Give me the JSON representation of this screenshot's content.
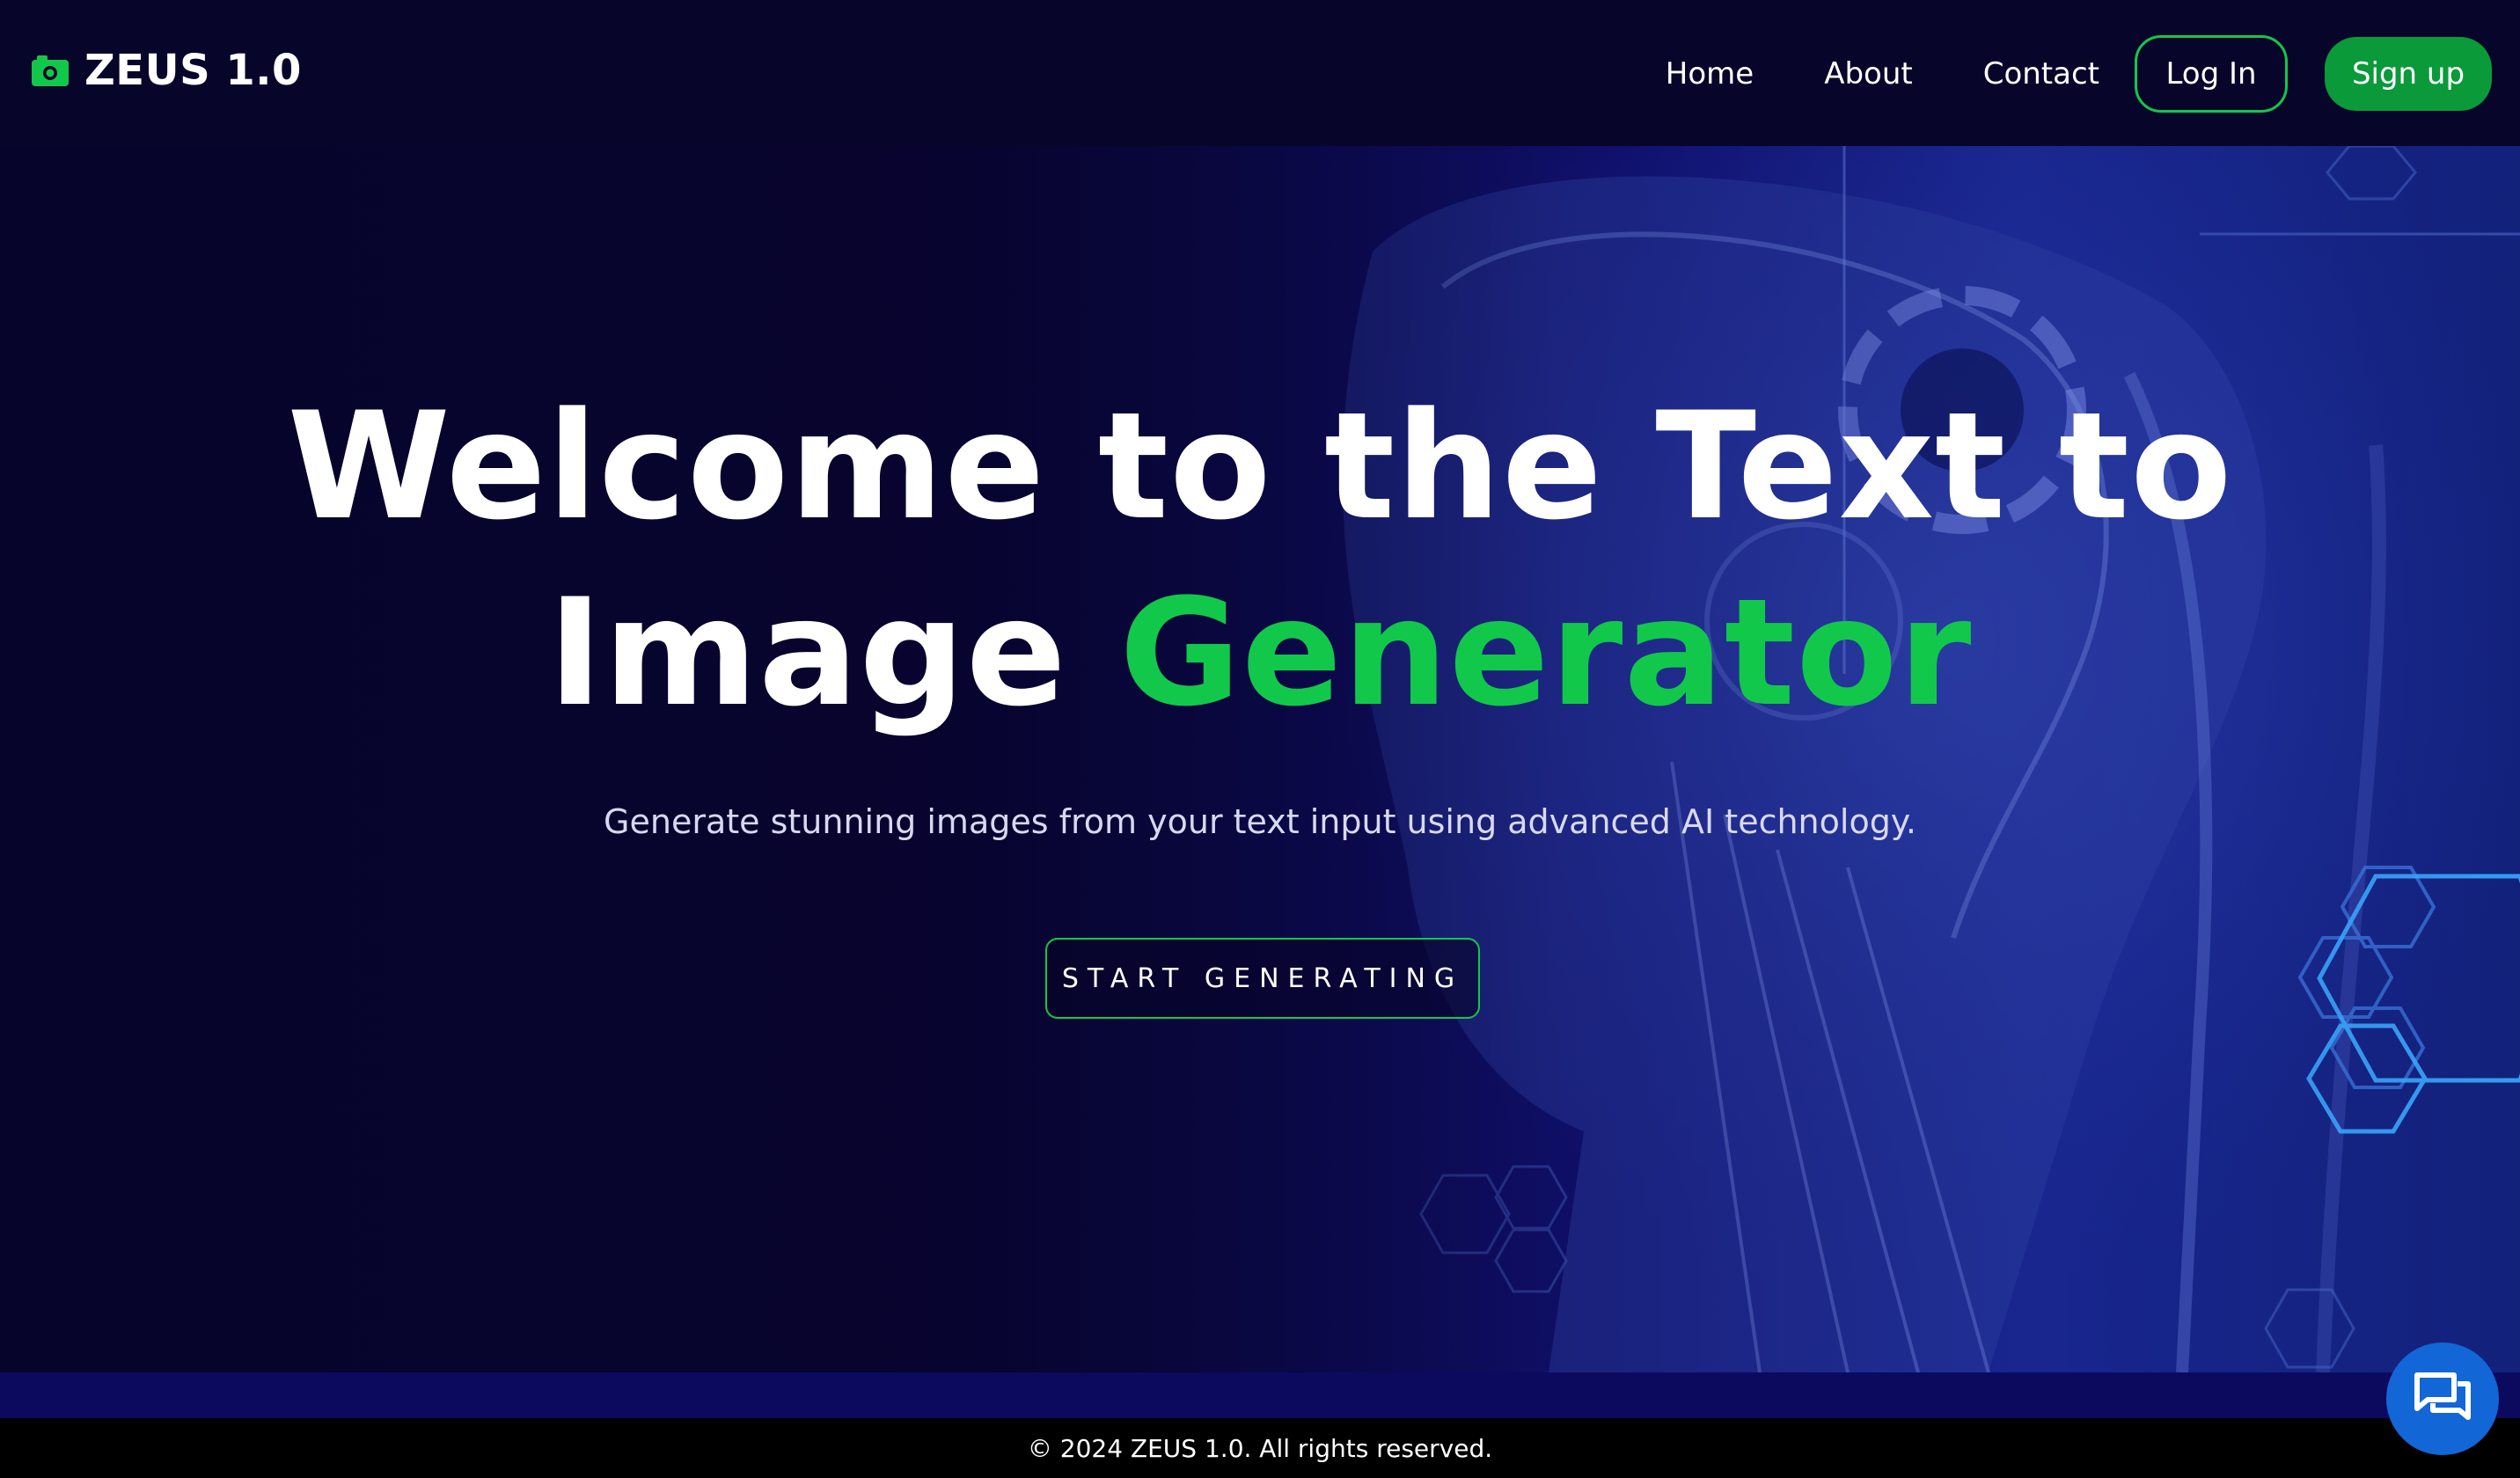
{
  "header": {
    "brand": "ZEUS 1.0",
    "brand_icon": "camera-icon",
    "nav": {
      "home": "Home",
      "about": "About",
      "contact": "Contact",
      "login": "Log In",
      "signup": "Sign up"
    }
  },
  "hero": {
    "headline_line1": "Welcome to the Text to",
    "headline_line2_plain": "Image",
    "headline_line2_accent": "Generator",
    "subtitle": "Generate stunning images from your text input using advanced AI technology.",
    "cta": "START GENERATING"
  },
  "footer": {
    "text": "© 2024 ZEUS 1.0. All rights reserved."
  },
  "chat_button_icon": "chat-icon",
  "colors": {
    "accent_green": "#12c84a",
    "signup_green": "#0a9a3a",
    "background": "#07052a",
    "chat_blue": "#1366d6"
  }
}
